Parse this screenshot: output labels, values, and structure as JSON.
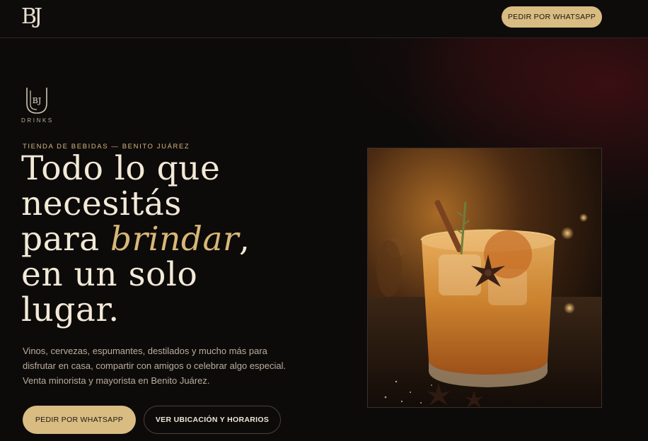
{
  "header": {
    "logo_text": "BJ",
    "whatsapp_label": "PEDIR POR WHATSAPP"
  },
  "hero": {
    "brand_mark": "BJ",
    "brand_word": "DRINKS",
    "eyebrow": "TIENDA DE BEBIDAS — BENITO JUÁREZ",
    "headline_line1": "Todo lo que",
    "headline_line2": "necesitás",
    "headline_line3_pre": "para ",
    "headline_line3_accent": "brindar",
    "headline_line3_post": ",",
    "headline_line4": "en un solo",
    "headline_line5": "lugar.",
    "description": "Vinos, cervezas, espumantes, destilados y mucho más para disfrutar en casa, compartir con amigos o celebrar algo especial. Venta minorista y mayorista en Benito Juárez.",
    "primary_cta": "PEDIR POR WHATSAPP",
    "secondary_cta": "VER UBICACIÓN Y HORARIOS"
  },
  "colors": {
    "background": "#0d0b0a",
    "accent_gold": "#d8bc82",
    "headline_text": "#f2e9d7",
    "wine_glow": "#5c1218"
  },
  "icons": {
    "hero_image": "cocktail-photo"
  }
}
